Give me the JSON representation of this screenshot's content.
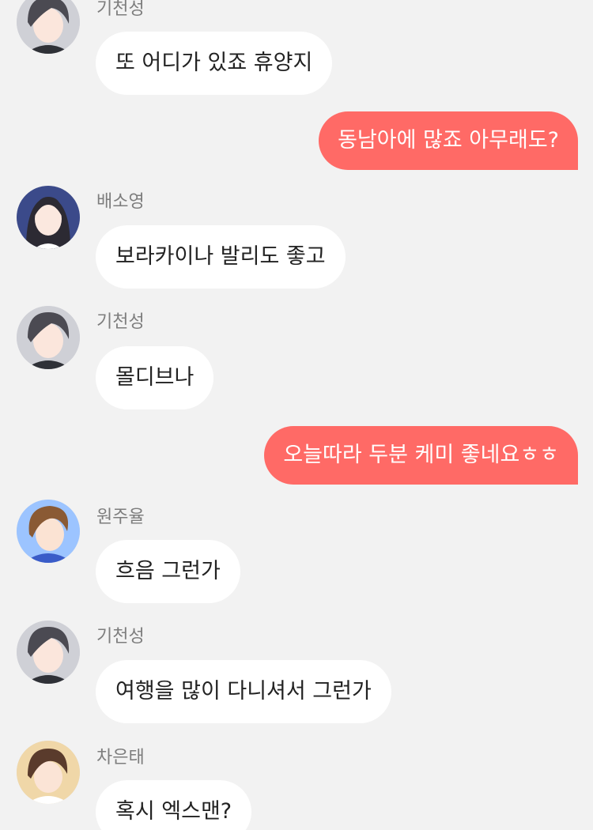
{
  "messages": [
    {
      "type": "in",
      "sender": "기천성",
      "avatar": "avatar-gicheonseong",
      "text": "또 어디가 있죠 휴양지"
    },
    {
      "type": "out",
      "text": "동남아에 많죠 아무래도?"
    },
    {
      "type": "in",
      "sender": "배소영",
      "avatar": "avatar-baesoyeong",
      "text": "보라카이나 발리도 좋고"
    },
    {
      "type": "in",
      "sender": "기천성",
      "avatar": "avatar-gicheonseong",
      "text": "몰디브나"
    },
    {
      "type": "out",
      "text": "오늘따라 두분 케미 좋네요ㅎㅎ"
    },
    {
      "type": "in",
      "sender": "원주율",
      "avatar": "avatar-wonjuyul",
      "text": "흐음 그런가"
    },
    {
      "type": "in",
      "sender": "기천성",
      "avatar": "avatar-gicheonseong",
      "text": "여행을 많이 다니셔서 그런가"
    },
    {
      "type": "in",
      "sender": "차은태",
      "avatar": "avatar-chaeuntae",
      "text": "혹시 엑스맨?"
    }
  ],
  "colors": {
    "background": "#f2f2f2",
    "incoming_bubble": "#ffffff",
    "outgoing_bubble": "#ff6a66",
    "sender_name": "#7d7d7d"
  }
}
